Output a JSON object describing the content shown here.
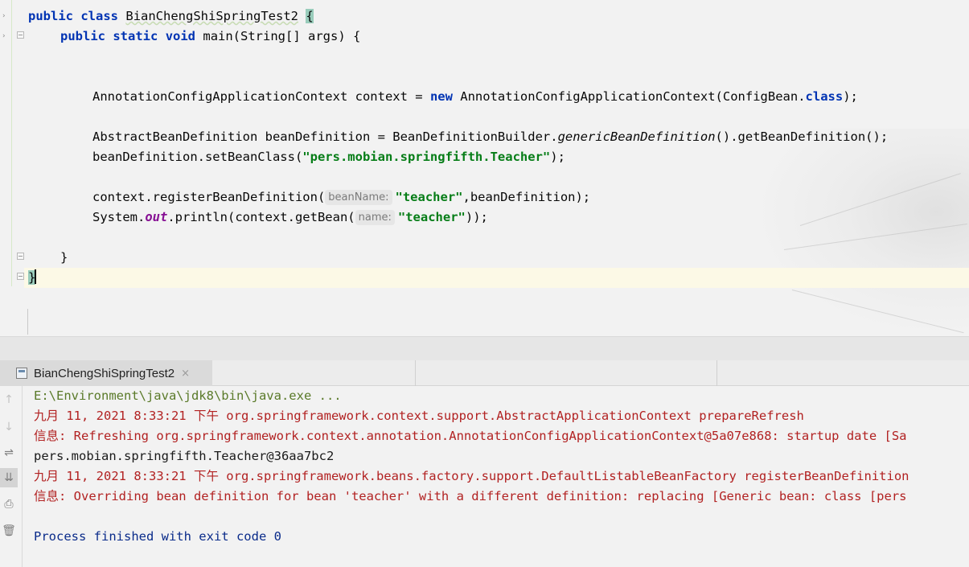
{
  "editor": {
    "line1": {
      "kw1": "public",
      "kw2": "class",
      "class_name": "BianChengShiSpringTest2",
      "brace": "{"
    },
    "line2": {
      "kw1": "public",
      "kw2": "static",
      "kw3": "void",
      "rest": "main(String[] args) {"
    },
    "line3": {
      "a": "AnnotationConfigApplicationContext context = ",
      "kw": "new",
      "b": " AnnotationConfigApplicationContext(ConfigBean.",
      "kw2": "class",
      "c": ");"
    },
    "line4": {
      "a": "AbstractBeanDefinition beanDefinition = BeanDefinitionBuilder.",
      "method": "genericBeanDefinition",
      "b": "().getBeanDefinition();"
    },
    "line5": {
      "a": "beanDefinition.setBeanClass(",
      "str": "\"pers.mobian.springfifth.Teacher\"",
      "b": ");"
    },
    "line6": {
      "a": "context.registerBeanDefinition(",
      "hint": "beanName:",
      "str": "\"teacher\"",
      "b": ",beanDefinition);"
    },
    "line7": {
      "a": "System.",
      "field": "out",
      "b": ".println(context.getBean(",
      "hint": "name:",
      "str": "\"teacher\"",
      "c": "));"
    },
    "line8": {
      "brace": "}"
    },
    "line9": {
      "brace": "}"
    }
  },
  "run_panel": {
    "tab_label": "BianChengShiSpringTest2",
    "tab_close": "×",
    "side_icons": [
      "arrow-up-icon",
      "arrow-down-icon",
      "soft-wrap-icon",
      "scroll-to-end-icon",
      "print-icon",
      "trash-icon"
    ],
    "console": [
      {
        "text": "E:\\Environment\\java\\jdk8\\bin\\java.exe ...",
        "kind": "cmd"
      },
      {
        "text": "九月 11, 2021 8:33:21 下午 org.springframework.context.support.AbstractApplicationContext prepareRefresh",
        "kind": "red"
      },
      {
        "text": "信息: Refreshing org.springframework.context.annotation.AnnotationConfigApplicationContext@5a07e868: startup date [Sa",
        "kind": "red"
      },
      {
        "text": "pers.mobian.springfifth.Teacher@36aa7bc2",
        "kind": "out"
      },
      {
        "text": "九月 11, 2021 8:33:21 下午 org.springframework.beans.factory.support.DefaultListableBeanFactory registerBeanDefinition",
        "kind": "red"
      },
      {
        "text": "信息: Overriding bean definition for bean 'teacher' with a different definition: replacing [Generic bean: class [pers",
        "kind": "red"
      },
      {
        "text": "",
        "kind": "out"
      },
      {
        "text": "Process finished with exit code 0",
        "kind": "blue"
      }
    ]
  },
  "colors": {
    "keyword": "#0033b3",
    "string": "#067d17",
    "static_field": "#871094",
    "console_red": "#b22222",
    "console_blue": "#0a2b8a",
    "console_cmd": "#5a7a29"
  }
}
